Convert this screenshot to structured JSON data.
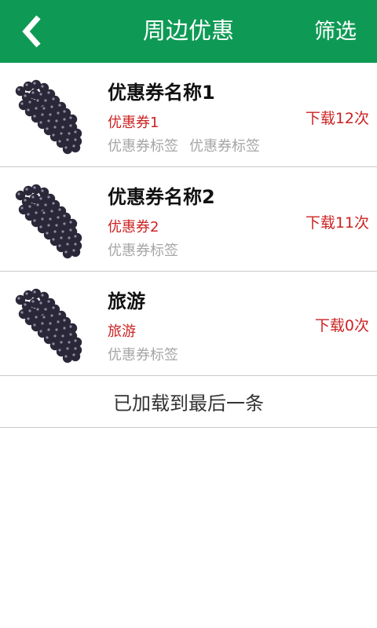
{
  "header": {
    "title": "周边优惠",
    "filter_label": "筛选",
    "back_icon": "chevron-left-icon",
    "bg_color": "#0e9a55"
  },
  "items": [
    {
      "title": "优惠券名称1",
      "subtitle": "优惠券1",
      "tags": [
        "优惠券标签",
        "优惠券标签"
      ],
      "downloads": "下载12次",
      "image": "grapes-image"
    },
    {
      "title": "优惠券名称2",
      "subtitle": "优惠券2",
      "tags": [
        "优惠券标签"
      ],
      "downloads": "下载11次",
      "image": "grapes-image"
    },
    {
      "title": "旅游",
      "subtitle": "旅游",
      "tags": [
        "优惠券标签"
      ],
      "downloads": "下载0次",
      "image": "grapes-image"
    }
  ],
  "footer": {
    "end_text": "已加载到最后一条"
  },
  "colors": {
    "accent_red": "#cc2222",
    "tag_gray": "#a6a6a6"
  }
}
